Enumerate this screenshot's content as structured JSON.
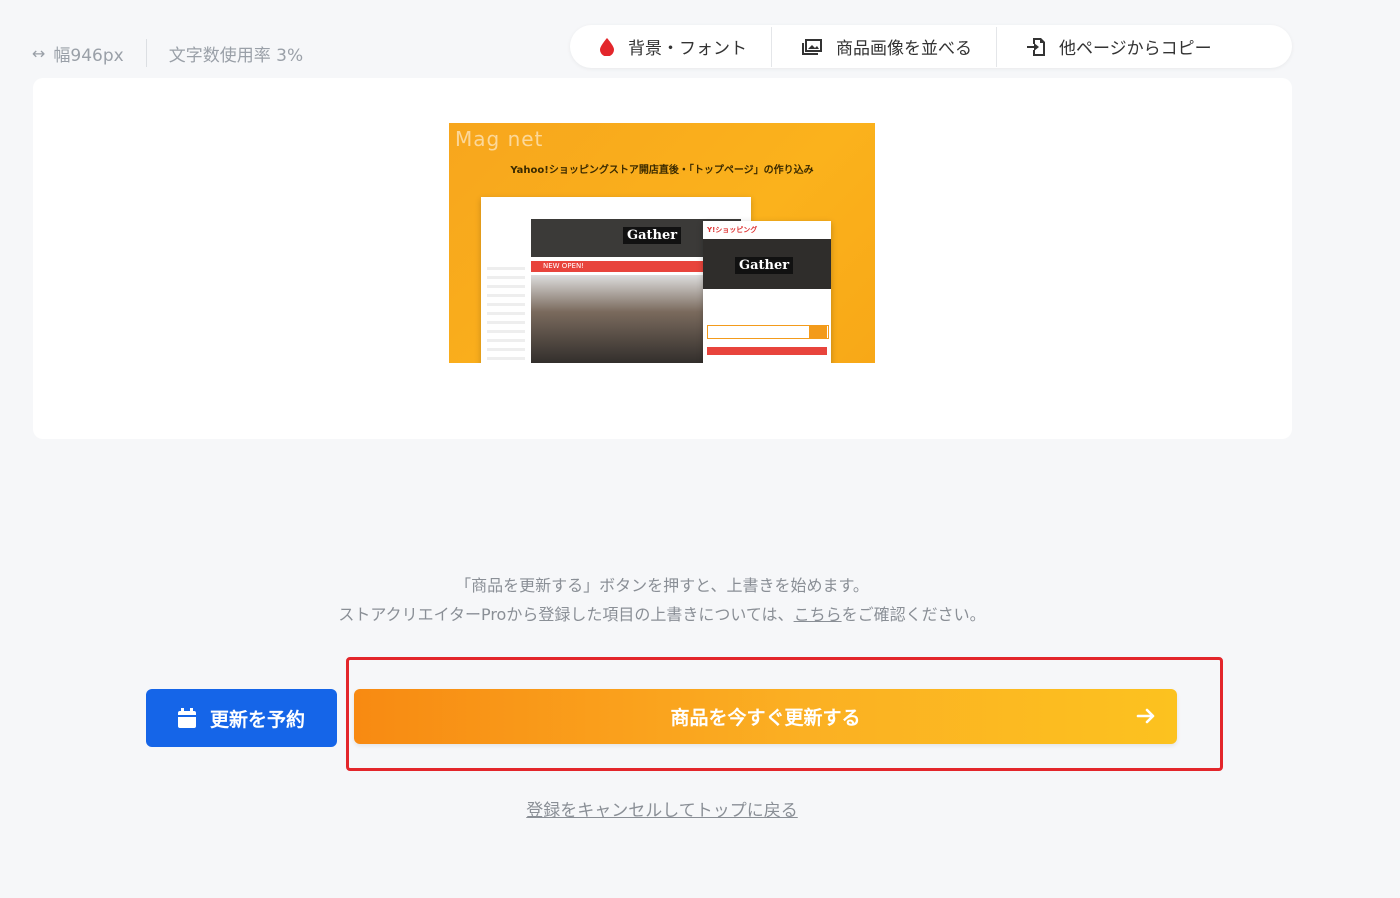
{
  "info": {
    "width_label": "幅946px",
    "char_usage_label": "文字数使用率 3%"
  },
  "toolbar": {
    "background_font": "背景・フォント",
    "arrange_images": "商品画像を並べる",
    "copy_from_page": "他ページからコピー"
  },
  "preview": {
    "logo_text": "Mag net",
    "headline": "Yahoo!ショッピングストア開店直後・「トップページ」の作り込み",
    "gather_text": "Gather",
    "new_open": "NEW OPEN!",
    "yahoo_label": "Y!ショッピング"
  },
  "notice": {
    "line1": "「商品を更新する」ボタンを押すと、上書きを始めます。",
    "line2_before": "ストアクリエイターProから登録した項目の上書きについては、",
    "line2_link": "こちら",
    "line2_after": "をご確認ください。"
  },
  "buttons": {
    "schedule_label": "更新を予約",
    "update_now_label": "商品を今すぐ更新する",
    "cancel_label": "登録をキャンセルしてトップに戻る"
  },
  "colors": {
    "primary_blue": "#1565e8",
    "update_orange_start": "#f88a12",
    "update_orange_end": "#fcc21f",
    "highlight_red": "#e3262b",
    "icon_drop_red": "#e3262b"
  }
}
